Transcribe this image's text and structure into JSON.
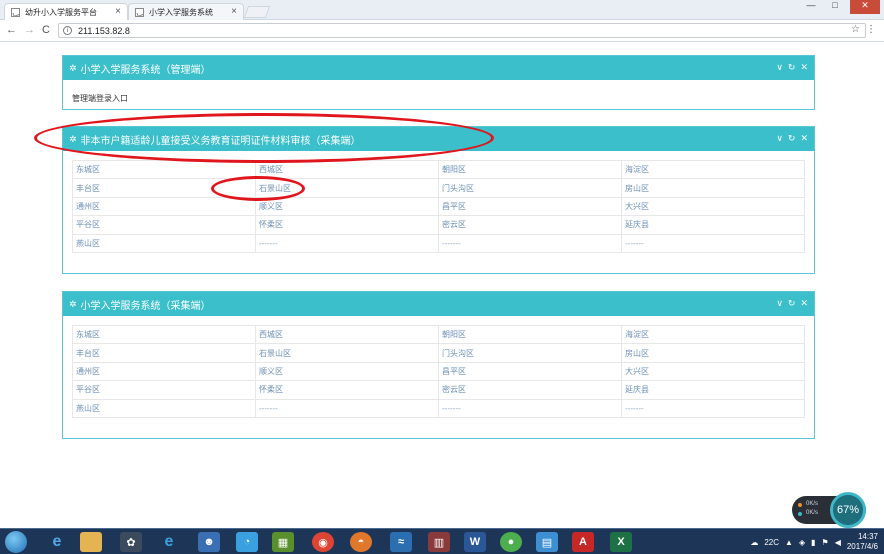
{
  "browser": {
    "tabs": [
      {
        "title": "幼升小入学服务平台",
        "active": true
      },
      {
        "title": "小学入学服务系统",
        "active": false
      }
    ],
    "address": "211.153.82.8",
    "window_controls": {
      "minimize": "—",
      "maximize": "□",
      "close": "✕"
    }
  },
  "panels": [
    {
      "title": "小学入学服务系统（管理端）",
      "type": "admin",
      "link": "管理端登录入口"
    },
    {
      "title": "非本市户籍适龄儿童接受义务教育证明证件材料审核（采集端）",
      "type": "grid",
      "rows": [
        [
          "东城区",
          "西城区",
          "朝阳区",
          "海淀区"
        ],
        [
          "丰台区",
          "石景山区",
          "门头沟区",
          "房山区"
        ],
        [
          "通州区",
          "顺义区",
          "昌平区",
          "大兴区"
        ],
        [
          "平谷区",
          "怀柔区",
          "密云区",
          "延庆县"
        ],
        [
          "燕山区",
          "-------",
          "-------",
          "-------"
        ]
      ]
    },
    {
      "title": "小学入学服务系统（采集端）",
      "type": "grid",
      "rows": [
        [
          "东城区",
          "西城区",
          "朝阳区",
          "海淀区"
        ],
        [
          "丰台区",
          "石景山区",
          "门头沟区",
          "房山区"
        ],
        [
          "通州区",
          "顺义区",
          "昌平区",
          "大兴区"
        ],
        [
          "平谷区",
          "怀柔区",
          "密云区",
          "延庆县"
        ],
        [
          "燕山区",
          "-------",
          "-------",
          "-------"
        ]
      ]
    }
  ],
  "panel_tools": {
    "collapse": "∨",
    "refresh": "↻",
    "close": "✕"
  },
  "widget": {
    "percent": "67%",
    "up": "0K/s",
    "down": "0K/s"
  },
  "taskbar": {
    "weather": "22C",
    "time": "14:37",
    "date": "2017/4/6",
    "pinned": [
      "e",
      "e",
      "W",
      "A",
      "X"
    ]
  },
  "colors": {
    "panel_header": "#3bbfcb",
    "annotation": "#e0161c",
    "link": "#6b8fb5"
  }
}
